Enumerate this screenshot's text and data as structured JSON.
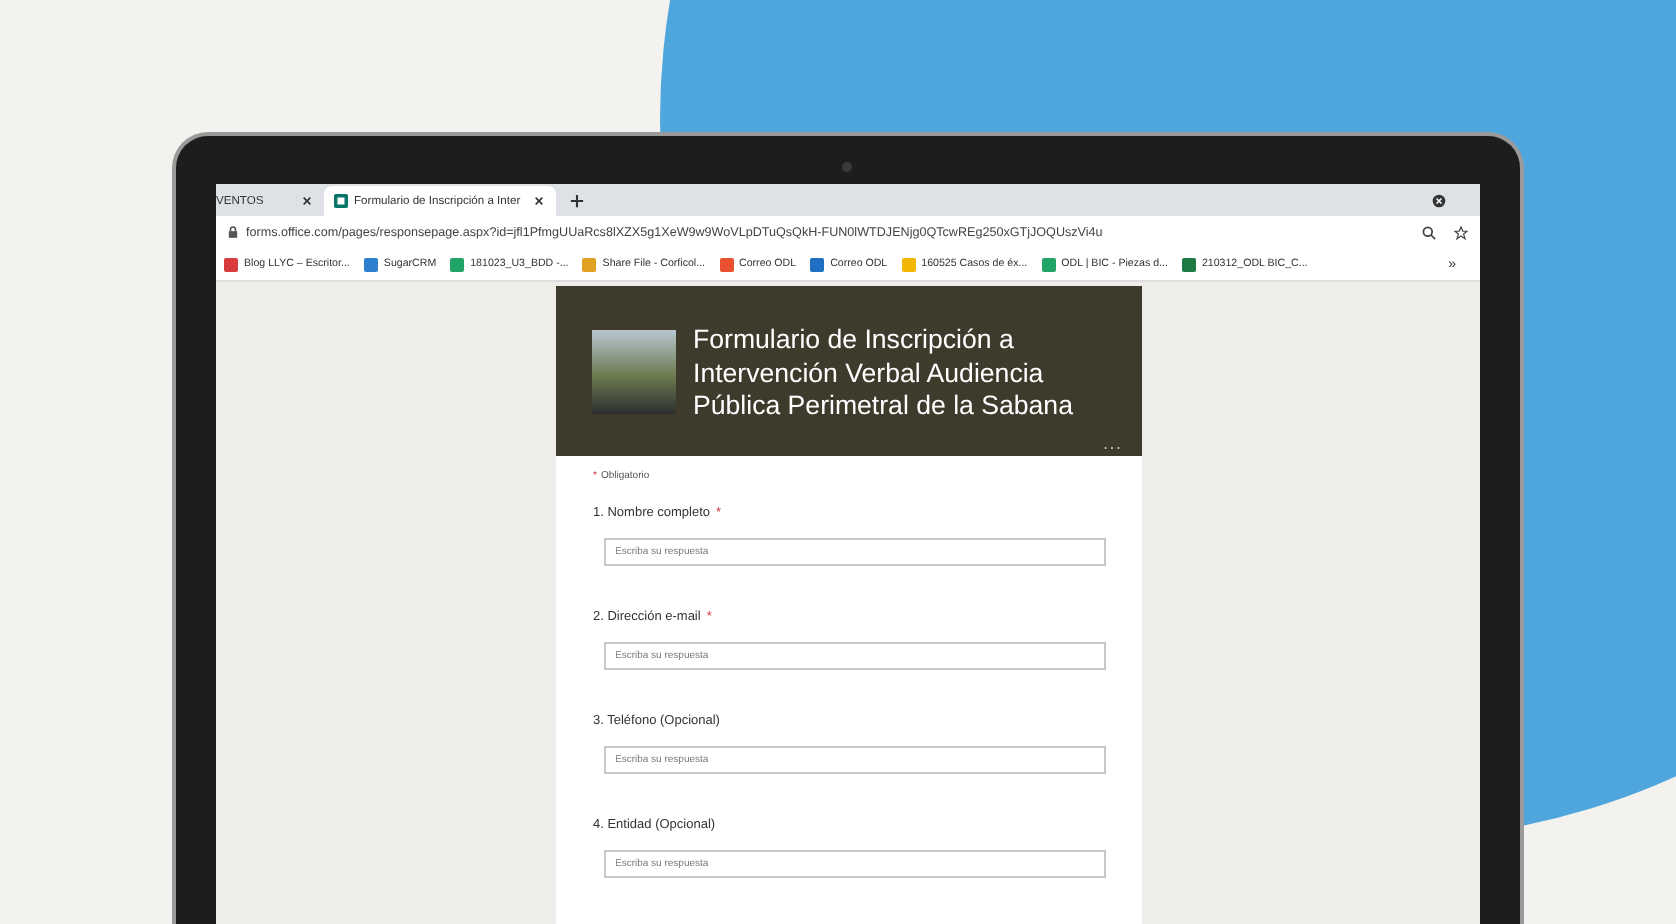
{
  "browser": {
    "tabs": [
      {
        "title": "VENTOS",
        "selected": false
      },
      {
        "title": "Formulario de Inscripción a Inter",
        "selected": true
      }
    ],
    "address": "forms.office.com/pages/responsepage.aspx?id=jfl1PfmgUUaRcs8lXZX5g1XeW9w9WoVLpDTuQsQkH-FUN0lWTDJENjg0QTcwREg250xGTjJOQUszVi4u",
    "bookmarks": [
      {
        "label": "Blog LLYC – Escritor...",
        "color": "#d83b3b"
      },
      {
        "label": "SugarCRM",
        "color": "#2f7fd0"
      },
      {
        "label": "181023_U3_BDD -...",
        "color": "#21a366"
      },
      {
        "label": "Share File - Corficol...",
        "color": "#e0a020"
      },
      {
        "label": "Correo ODL",
        "color": "#e8502f"
      },
      {
        "label": "Correo ODL",
        "color": "#1f6fc5"
      },
      {
        "label": "160525 Casos de éx...",
        "color": "#f2b705"
      },
      {
        "label": "ODL | BIC - Piezas d...",
        "color": "#21a366"
      },
      {
        "label": "210312_ODL BIC_C...",
        "color": "#1d7a45"
      }
    ],
    "overflow": "»"
  },
  "form": {
    "title": "Formulario de Inscripción a Intervención Verbal Audiencia Pública Perimetral de la Sabana",
    "required_note": {
      "mark": "*",
      "text": "Obligatorio"
    },
    "questions": [
      {
        "label": "1. Nombre completo",
        "mark": "*",
        "placeholder": "Escriba su respuesta"
      },
      {
        "label": "2. Dirección e-mail",
        "mark": "*",
        "placeholder": "Escriba su respuesta"
      },
      {
        "label": "3. Teléfono (Opcional)",
        "placeholder": "Escriba su respuesta"
      },
      {
        "label": "4. Entidad (Opcional)",
        "placeholder": "Escriba su respuesta"
      }
    ]
  }
}
